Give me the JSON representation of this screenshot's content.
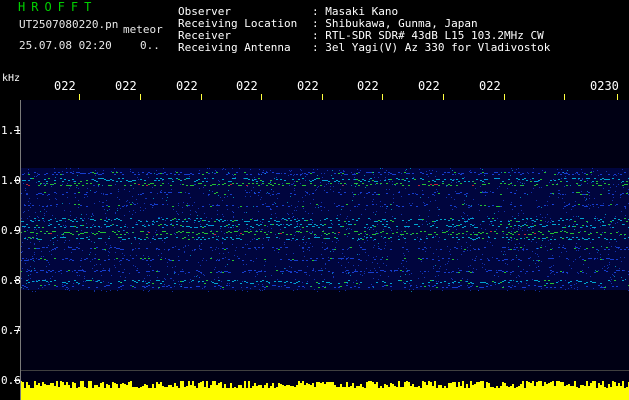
{
  "header": {
    "app_title": "HROFFT",
    "file_name": "UT2507080220.pn",
    "file_suffix": "meteor",
    "timestamp": "25.07.08 02:20",
    "misc_value": "0.."
  },
  "station_info": [
    {
      "label": "Observer",
      "value": ": Masaki Kano"
    },
    {
      "label": "Receiving Location",
      "value": ": Shibukawa, Gunma, Japan"
    },
    {
      "label": "Receiver",
      "value": ": RTL-SDR SDR# 43dB L15 103.2MHz CW"
    },
    {
      "label": "Receiving Antenna",
      "value": ": 3el Yagi(V) Az 330 for Vladivostok"
    }
  ],
  "axis": {
    "unit_label": "kHz",
    "x_tick_labels": [
      "022",
      "022",
      "022",
      "022",
      "022",
      "022",
      "022",
      "022",
      "0230"
    ],
    "y_tick_labels": [
      "1.1",
      "1.0",
      "0.9",
      "0.8",
      "0.7",
      "0.6"
    ]
  },
  "colors": {
    "background": "#000000",
    "plot_background": "#000014",
    "title_green": "#00d000",
    "tick_yellow": "#ffff40",
    "bottom_band_yellow": "#ffff00",
    "signal_blue": "#1e50ff",
    "signal_cyan": "#00d8ff",
    "signal_green": "#30ff30",
    "signal_red": "#ff3030"
  }
}
